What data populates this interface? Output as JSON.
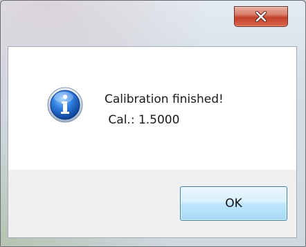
{
  "window": {
    "close_icon": "close-icon"
  },
  "dialog": {
    "icon": "info-icon",
    "message_line1": "Calibration finished!",
    "message_line2": " Cal.: 1.5000",
    "ok_label": "OK"
  },
  "colors": {
    "close_button": "#c4412b",
    "info_icon": "#1f5fbf",
    "ok_border": "#3c7fb1"
  }
}
